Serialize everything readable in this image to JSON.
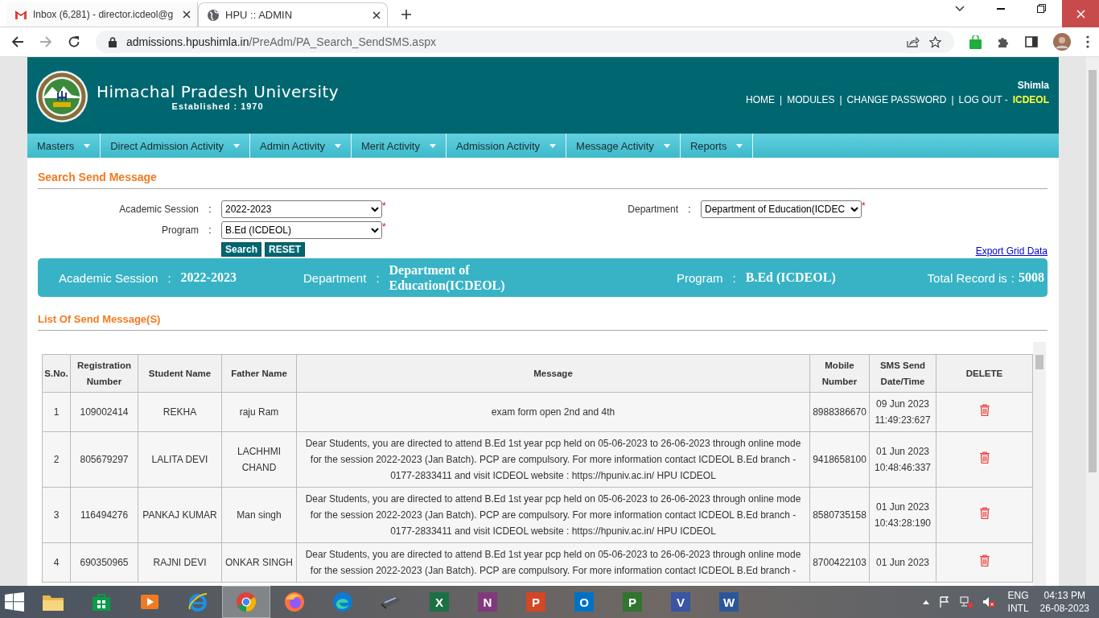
{
  "browser": {
    "tabs": [
      {
        "title": "Inbox (6,281) - director.icdeol@g",
        "kind": "mail",
        "selected": false
      },
      {
        "title": "HPU :: ADMIN",
        "kind": "globe",
        "selected": true
      }
    ],
    "url": {
      "host": "admissions.hpushimla.in",
      "path": "/PreAdm/PA_Search_SendSMS.aspx"
    }
  },
  "header": {
    "name": "Himachal Pradesh University",
    "established": "Established : 1970",
    "city": "Shimla",
    "links": [
      "HOME",
      "MODULES",
      "CHANGE PASSWORD"
    ],
    "separator": "|",
    "logout": "LOG OUT -",
    "user": "ICDEOL"
  },
  "menu": [
    "Masters",
    "Direct Admission Activity",
    "Admin Activity",
    "Merit Activity",
    "Admission Activity",
    "Message Activity",
    "Reports"
  ],
  "search": {
    "title": "Search Send Message",
    "separator": ":",
    "required_mark": "*",
    "fields": [
      {
        "label": "Academic Session",
        "value": "2022-2023",
        "required": true
      },
      {
        "label": "Program",
        "value": "B.Ed (ICDEOL)",
        "required": true
      },
      {
        "label": "Department",
        "value": "Department of Education(ICDEC",
        "required": true
      }
    ],
    "buttons": [
      "Search",
      "RESET"
    ],
    "export": "Export Grid Data"
  },
  "summary": {
    "separator": ":",
    "items": [
      {
        "label": "Academic Session",
        "value": "2022-2023"
      },
      {
        "label": "Department",
        "value": "Department of Education(ICDEOL)"
      },
      {
        "label": "Program",
        "value": "B.Ed (ICDEOL)"
      }
    ],
    "total_label": "Total Record is",
    "total_value": "5008"
  },
  "list_title": "List Of Send Message(S)",
  "table": {
    "columns": [
      "S.No.",
      "Registration Number",
      "Student Name",
      "Father Name",
      "Message",
      "Mobile Number",
      "SMS Send Date/Time",
      "DELETE"
    ],
    "rows": [
      {
        "sno": "1",
        "reg": "109002414",
        "student": "REKHA",
        "father": "raju Ram",
        "message": "exam form open 2nd and 4th",
        "mobile": "8988386670",
        "date": "09 Jun 2023",
        "time": "11:49:23:627"
      },
      {
        "sno": "2",
        "reg": "805679297",
        "student": "LALITA DEVI",
        "father": "LACHHMI CHAND",
        "message": "Dear Students, you are directed to attend B.Ed 1st year pcp held on 05-06-2023 to 26-06-2023 through online mode for the session 2022-2023 (Jan Batch). PCP are compulsory. For more information contact ICDEOL B.Ed branch - 0177-2833411 and visit ICDEOL website : https://hpuniv.ac.in/ HPU ICDEOL",
        "mobile": "9418658100",
        "date": "01 Jun 2023",
        "time": "10:48:46:337"
      },
      {
        "sno": "3",
        "reg": "116494276",
        "student": "PANKAJ KUMAR",
        "father": "Man singh",
        "message": "Dear Students, you are directed to attend B.Ed 1st year pcp held on 05-06-2023 to 26-06-2023 through online mode for the session 2022-2023 (Jan Batch). PCP are compulsory. For more information contact ICDEOL B.Ed branch - 0177-2833411 and visit ICDEOL website : https://hpuniv.ac.in/ HPU ICDEOL",
        "mobile": "8580735158",
        "date": "01 Jun 2023",
        "time": "10:43:28:190"
      },
      {
        "sno": "4",
        "reg": "690350965",
        "student": "RAJNI DEVI",
        "father": "ONKAR SINGH",
        "message": "Dear Students, you are directed to attend B.Ed 1st year pcp held on 05-06-2023 to 26-06-2023 through online mode for the session 2022-2023 (Jan Batch). PCP are compulsory. For more information contact ICDEOL B.Ed branch -",
        "mobile": "8700422103",
        "date": "01 Jun 2023"
      }
    ]
  },
  "taskbar": {
    "apps": [
      {
        "kind": "folder",
        "selected": false
      },
      {
        "kind": "store",
        "selected": false
      },
      {
        "kind": "media",
        "selected": false
      },
      {
        "kind": "ie",
        "selected": false
      },
      {
        "kind": "chrome",
        "selected": true
      },
      {
        "kind": "firefox",
        "selected": false
      },
      {
        "kind": "edge",
        "selected": false
      },
      {
        "kind": "scanner",
        "selected": false
      },
      {
        "kind": "letter",
        "letter": "X",
        "color": "#1d7044",
        "selected": false
      },
      {
        "kind": "letter",
        "letter": "N",
        "color": "#80397b",
        "selected": false
      },
      {
        "kind": "letter",
        "letter": "P",
        "color": "#d24726",
        "selected": false
      },
      {
        "kind": "letter",
        "letter": "O",
        "color": "#0072c6",
        "selected": false
      },
      {
        "kind": "letter",
        "letter": "P",
        "color": "#31752f",
        "selected": false
      },
      {
        "kind": "letter",
        "letter": "V",
        "color": "#3955a3",
        "selected": false
      },
      {
        "kind": "letter",
        "letter": "W",
        "color": "#2b579a",
        "selected": false
      }
    ],
    "lang": "ENG",
    "layout": "INTL",
    "time": "04:13 PM",
    "date": "26-08-2023"
  }
}
